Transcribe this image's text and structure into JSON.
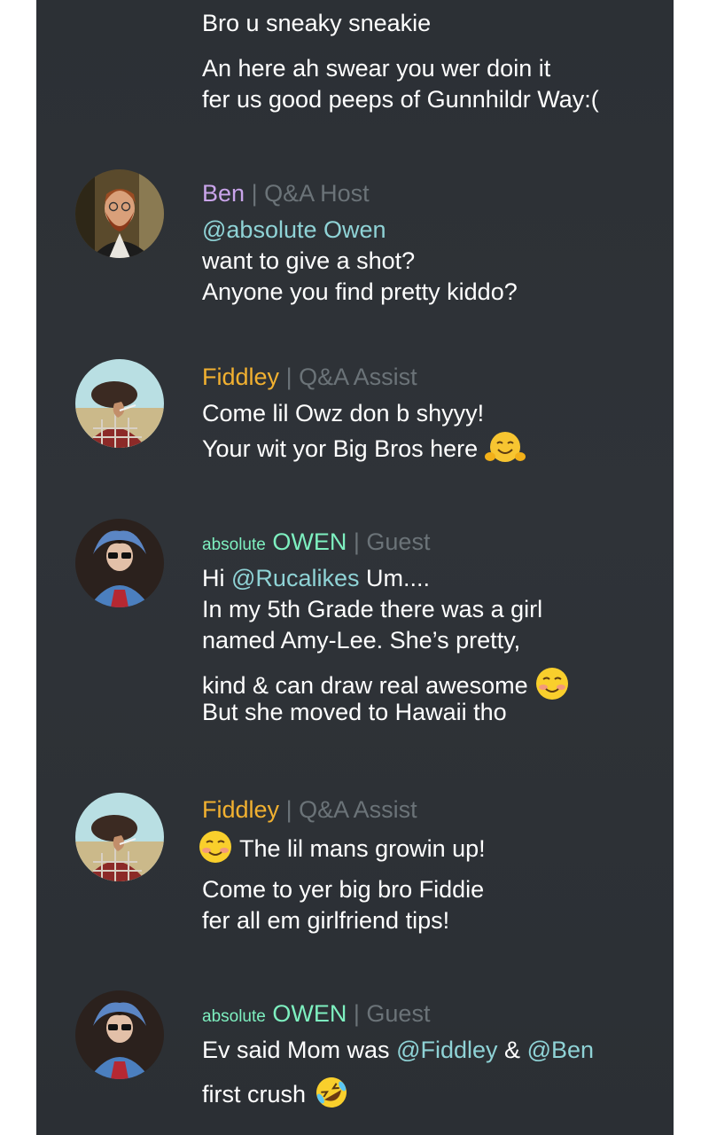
{
  "messages": [
    {
      "author": "",
      "lines": [
        {
          "text": "Bro u sneaky sneakie"
        },
        {
          "text": "An here ah swear you wer doin it"
        },
        {
          "text": "fer us good peeps of Gunnhildr Way:("
        }
      ]
    },
    {
      "author": "Ben",
      "role": "Q&A Host",
      "separator": "|",
      "avatar": "ben-avatar",
      "lines": [
        {
          "mention": "@absolute Owen"
        },
        {
          "text": "want to give a shot?"
        },
        {
          "text": "Anyone you find pretty kiddo?"
        }
      ]
    },
    {
      "author": "Fiddley",
      "role": "Q&A Assist",
      "separator": "|",
      "avatar": "fiddley-avatar",
      "lines": [
        {
          "text": "Come lil Owz don b shyyy!"
        },
        {
          "text": "Your wit yor Big Bros here",
          "emoji": "hugging-face-emoji"
        }
      ]
    },
    {
      "prefix": "absolute",
      "author": "OWEN",
      "role": "Guest",
      "separator": "|",
      "avatar": "owen-avatar",
      "lines": [
        {
          "text_before": "Hi",
          "mention": "@Rucalikes",
          "text_after": "Um...."
        },
        {
          "text": "In my 5th Grade there was a girl"
        },
        {
          "text": "named Amy-Lee. She’s pretty,"
        },
        {
          "text": "kind & can draw real awesome",
          "emoji": "smiling-blush-emoji"
        },
        {
          "text": "But she moved to Hawaii tho"
        }
      ]
    },
    {
      "author": "Fiddley",
      "role": "Q&A Assist",
      "separator": "|",
      "avatar": "fiddley-avatar",
      "lines": [
        {
          "text": "The lil mans growin up!",
          "emoji": "smiling-blush-emoji"
        },
        {
          "text": "Come to yer big bro Fiddie"
        },
        {
          "text": "fer all em girlfriend tips!"
        }
      ]
    },
    {
      "prefix": "absolute",
      "author": "OWEN",
      "role": "Guest",
      "separator": "|",
      "avatar": "owen-avatar",
      "lines": [
        {
          "text_before": "Ev said Mom was",
          "mention": "@Fiddley",
          "text_mid": "&",
          "mention2": "@Ben"
        },
        {
          "text": "first crush",
          "emoji": "rolling-laughing-emoji"
        }
      ]
    }
  ],
  "colors": {
    "background": "#2e3237",
    "ben_name": "#c9a4ea",
    "fiddley_name": "#f2b130",
    "owen_name": "#7ef0c0",
    "mention": "#8fd3d6",
    "role": "#6b7378",
    "text": "#ffffff"
  }
}
